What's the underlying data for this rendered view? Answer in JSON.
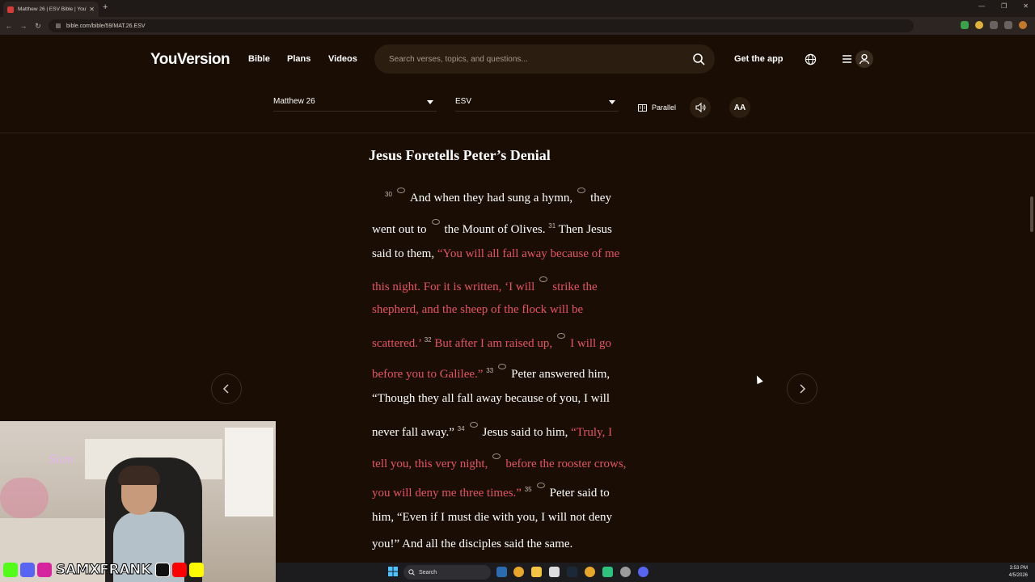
{
  "browser": {
    "tab_title": "Matthew 26 | ESV Bible | YouVe",
    "url": "bible.com/bible/59/MAT.26.ESV"
  },
  "site": {
    "logo": "YouVersion",
    "nav": [
      "Bible",
      "Plans",
      "Videos"
    ],
    "search_placeholder": "Search verses, topics, and questions...",
    "get_app": "Get the app"
  },
  "reader_controls": {
    "book_chapter": "Matthew 26",
    "version": "ESV",
    "parallel": "Parallel",
    "font_button": "AA"
  },
  "passage": {
    "heading": "Jesus Foretells Peter’s Denial",
    "l1": {
      "vn": "30",
      "a": "And when they had sung a hymn,",
      "b": "they"
    },
    "l2": {
      "a": "went out to",
      "b": "the Mount of Olives.",
      "vn": "31",
      "c": "Then Jesus"
    },
    "l3": {
      "a": "said to them,",
      "r": "“You will all fall away because of me"
    },
    "l4": {
      "r1": "this night. For it is written, ‘I will",
      "r2": "strike the"
    },
    "l5": {
      "r": "shepherd, and the sheep of the flock will be"
    },
    "l6": {
      "r1": "scattered.’",
      "vn": "32",
      "r2": "But after I am raised up,",
      "r3": "I will go"
    },
    "l7": {
      "r": "before you to Galilee.”",
      "vn": "33",
      "a": "Peter answered him,"
    },
    "l8": {
      "a": "“Though they all fall away because of you, I will"
    },
    "l9": {
      "a": "never fall away.”",
      "vn": "34",
      "b": "Jesus said to him,",
      "r": "“Truly, I"
    },
    "l10": {
      "r1": "tell you, this very night,",
      "r2": "before the rooster crows,"
    },
    "l11": {
      "r": "you will deny me three times.”",
      "vn": "35",
      "a": "Peter said to"
    },
    "l12": {
      "a": "him, “Even if I must die with you, I will not deny"
    },
    "l13": {
      "a": "you!” And all the disciples said the same."
    }
  },
  "overlay": {
    "handle": "SAMXFRANK",
    "sign": "Sam"
  },
  "taskbar": {
    "search": "Search",
    "time": "3:53 PM",
    "date": "4/5/2026"
  },
  "colors": {
    "background": "#1a0d04",
    "words_of_christ": "#e45561",
    "text": "#ffffff"
  }
}
